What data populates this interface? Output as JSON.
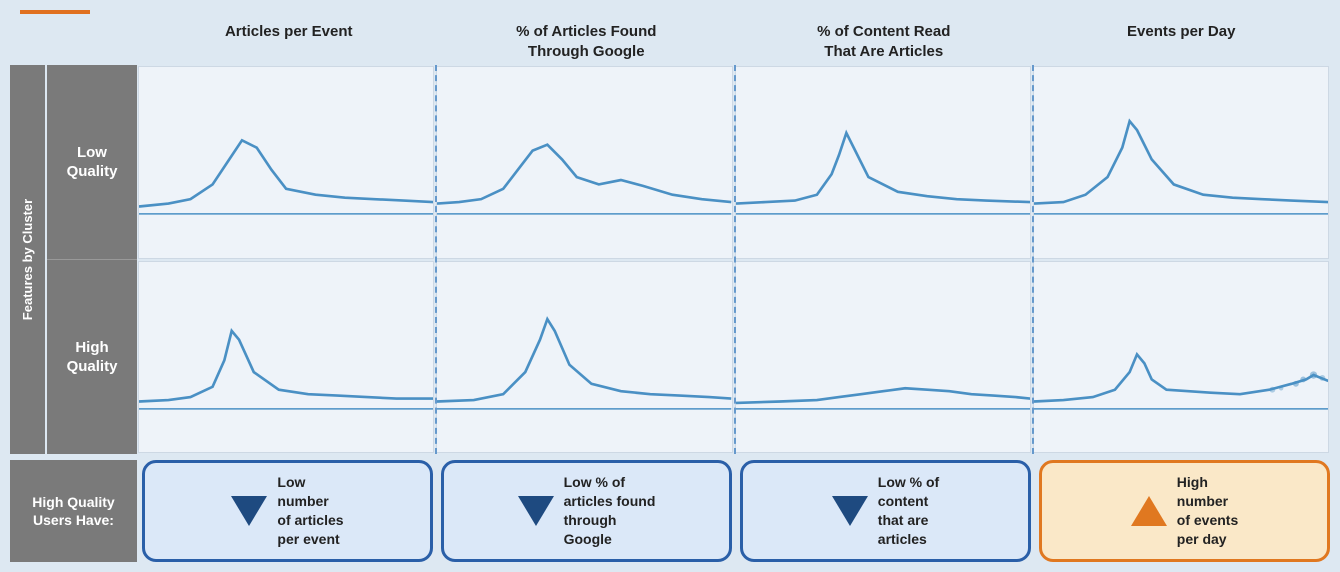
{
  "orange_line": true,
  "col_headers": [
    {
      "id": "col1",
      "text": "Articles per Event"
    },
    {
      "id": "col2",
      "text": "% of Articles Found\nThrough Google"
    },
    {
      "id": "col3",
      "text": "% of Content Read\nThat Are Articles"
    },
    {
      "id": "col4",
      "text": "Events per Day"
    }
  ],
  "row_label_outer": "Features by Cluster",
  "row_labels": [
    {
      "id": "low-quality",
      "text": "Low\nQuality"
    },
    {
      "id": "high-quality",
      "text": "High\nQuality"
    }
  ],
  "bottom_label": "High Quality\nUsers Have:",
  "insights": [
    {
      "id": "insight1",
      "direction": "down",
      "text": "Low\nnumber\nof articles\nper event",
      "color": "blue"
    },
    {
      "id": "insight2",
      "direction": "down",
      "text": "Low % of\narticles found\nthrough\nGoogle",
      "color": "blue"
    },
    {
      "id": "insight3",
      "direction": "down",
      "text": "Low % of\ncontent\nthat are\narticles",
      "color": "blue"
    },
    {
      "id": "insight4",
      "direction": "up",
      "text": "High\nnumber\nof events\nper day",
      "color": "orange"
    }
  ]
}
